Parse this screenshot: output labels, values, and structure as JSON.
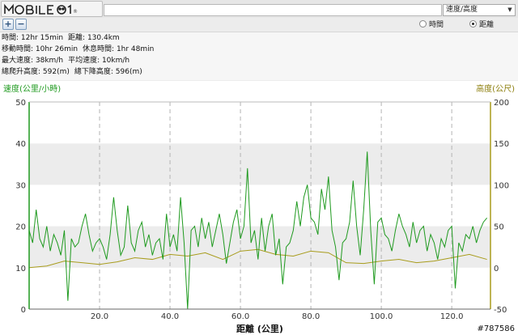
{
  "header": {
    "logo_text": "MOBILE01",
    "url_value": "",
    "mode_select": "速度/高度"
  },
  "toolbar": {
    "zoom_in": "+",
    "zoom_out": "−"
  },
  "axis_mode": {
    "time_label": "時間",
    "distance_label": "距離",
    "selected": "distance"
  },
  "stats": {
    "line1": [
      "時間: 12hr 15min",
      "距離: 130.4km"
    ],
    "line2": [
      "移動時間: 10hr 26min",
      "休息時間: 1hr 48min"
    ],
    "line3": [
      "最大速度: 38km/h",
      "平均速度: 10km/h"
    ],
    "line4": [
      "總爬升高度: 592(m)",
      "總下降高度: 596(m)"
    ]
  },
  "watermark": "#787586",
  "colors": {
    "speed": "#1f9a1f",
    "altitude": "#a89c1c",
    "left_axis_label": "#1f9a1f",
    "right_axis_label": "#8b7d0a"
  },
  "chart_data": {
    "type": "line",
    "xlabel": "距離 (公里)",
    "x_ticks": [
      "20.0",
      "40.0",
      "60.0",
      "80.0",
      "100.0",
      "120.0"
    ],
    "x_tick_values": [
      20,
      40,
      60,
      80,
      100,
      120
    ],
    "xlim": [
      0,
      131
    ],
    "left_axis": {
      "label": "速度(公里/小時)",
      "ticks": [
        "0",
        "10",
        "20",
        "30",
        "40",
        "50"
      ],
      "ylim": [
        0,
        50
      ]
    },
    "right_axis": {
      "label": "高度(公尺)",
      "ticks": [
        "-50",
        "0",
        "50",
        "100",
        "150",
        "200"
      ],
      "ylim": [
        -50,
        200
      ]
    },
    "grid": "dashed vertical",
    "series": [
      {
        "name": "速度",
        "axis": "left",
        "x": [
          0,
          1,
          2,
          3,
          4,
          5,
          6,
          7,
          8,
          9,
          10,
          11,
          12,
          13,
          14,
          15,
          16,
          17,
          18,
          19,
          20,
          21,
          22,
          23,
          24,
          25,
          26,
          27,
          28,
          29,
          30,
          31,
          32,
          33,
          34,
          35,
          36,
          37,
          38,
          39,
          40,
          41,
          42,
          43,
          44,
          45,
          46,
          47,
          48,
          49,
          50,
          51,
          52,
          53,
          54,
          55,
          56,
          57,
          58,
          59,
          60,
          61,
          62,
          63,
          64,
          65,
          66,
          67,
          68,
          69,
          70,
          71,
          72,
          73,
          74,
          75,
          76,
          77,
          78,
          79,
          80,
          81,
          82,
          83,
          84,
          85,
          86,
          87,
          88,
          89,
          90,
          91,
          92,
          93,
          94,
          95,
          96,
          97,
          98,
          99,
          100,
          101,
          102,
          103,
          104,
          105,
          106,
          107,
          108,
          109,
          110,
          111,
          112,
          113,
          114,
          115,
          116,
          117,
          118,
          119,
          120,
          121,
          122,
          123,
          124,
          125,
          126,
          127,
          128,
          129,
          130
        ],
        "values": [
          19,
          16,
          24,
          17,
          15,
          20,
          14,
          18,
          16,
          13,
          19,
          2,
          17,
          15,
          16,
          20,
          23,
          18,
          14,
          16,
          17,
          15,
          12,
          18,
          27,
          19,
          13,
          15,
          25,
          16,
          14,
          19,
          21,
          15,
          18,
          13,
          16,
          17,
          12,
          23,
          15,
          18,
          14,
          27,
          16,
          0,
          19,
          20,
          15,
          22,
          17,
          21,
          15,
          19,
          23,
          18,
          11,
          16,
          21,
          24,
          17,
          20,
          34,
          16,
          19,
          12,
          22,
          14,
          20,
          23,
          13,
          17,
          6,
          15,
          16,
          19,
          26,
          20,
          27,
          30,
          22,
          21,
          18,
          29,
          24,
          32,
          19,
          15,
          7,
          16,
          17,
          21,
          31,
          20,
          13,
          24,
          38,
          19,
          6,
          21,
          22,
          18,
          17,
          14,
          19,
          23,
          20,
          18,
          15,
          21,
          16,
          19,
          20,
          14,
          18,
          16,
          12,
          17,
          15,
          19,
          20,
          5,
          16,
          14,
          18,
          17,
          20,
          16,
          19,
          21,
          22
        ]
      },
      {
        "name": "高度",
        "axis": "right",
        "x": [
          0,
          5,
          10,
          15,
          20,
          25,
          30,
          35,
          40,
          45,
          50,
          55,
          60,
          65,
          70,
          75,
          80,
          85,
          90,
          95,
          100,
          105,
          110,
          115,
          120,
          125,
          130
        ],
        "values": [
          0,
          2,
          8,
          6,
          4,
          7,
          12,
          10,
          16,
          14,
          18,
          10,
          20,
          22,
          16,
          14,
          20,
          18,
          6,
          5,
          8,
          10,
          6,
          8,
          12,
          16,
          10
        ]
      }
    ]
  }
}
